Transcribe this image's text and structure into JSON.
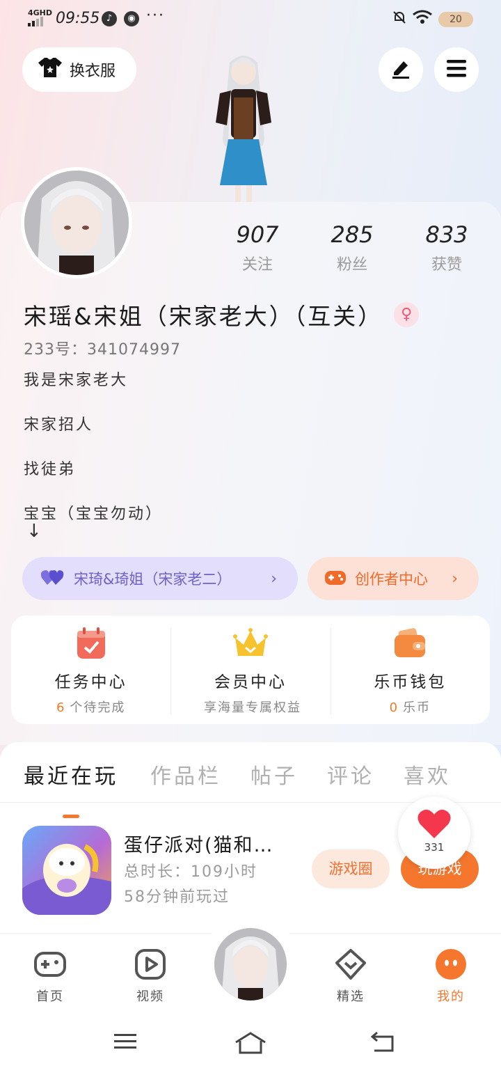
{
  "status_bar": {
    "network": "4GHD",
    "time": "09:55",
    "dots": "···",
    "battery": "20"
  },
  "header": {
    "outfit_label": "换衣服",
    "edit_icon": "pen-icon",
    "menu_icon": "hamburger-menu-icon"
  },
  "profile": {
    "stats": [
      {
        "value": "907",
        "label": "关注"
      },
      {
        "value": "285",
        "label": "粉丝"
      },
      {
        "value": "833",
        "label": "获赞"
      }
    ],
    "name": "宋瑶&宋姐（宋家老大）（互关）",
    "gender_icon": "female-icon",
    "uid": "233号：341074997",
    "bio": [
      "我是宋家老大",
      "宋家招人",
      "找徒弟",
      "宝宝（宝宝勿动）"
    ],
    "bio_arrow": "↓"
  },
  "relation": {
    "label": "宋琦&琦姐（宋家老二）",
    "icon": "double-heart-icon",
    "color": "#6e62c9"
  },
  "creator": {
    "label": "创作者中心",
    "icon": "gamepad-icon",
    "color": "#f06a2a"
  },
  "services": [
    {
      "title": "任务中心",
      "count": "6",
      "sub": "个待完成",
      "icon": "calendar-check-icon"
    },
    {
      "title": "会员中心",
      "count": "",
      "sub": "享海量专属权益",
      "icon": "crown-icon"
    },
    {
      "title": "乐币钱包",
      "count": "0",
      "sub": "乐币",
      "icon": "wallet-icon"
    }
  ],
  "tabs": [
    "最近在玩",
    "作品栏",
    "帖子",
    "评论",
    "喜欢"
  ],
  "active_tab": 0,
  "game": {
    "title": "蛋仔派对(猫和…",
    "total_time": "总时长：109小时",
    "last_played": "58分钟前玩过",
    "circle_label": "游戏圈",
    "play_label": "玩游戏"
  },
  "like_bubble": {
    "count": "331",
    "icon": "heart-icon"
  },
  "bottom_nav": [
    {
      "label": "首页",
      "icon": "gamepad-icon"
    },
    {
      "label": "视频",
      "icon": "play-icon"
    },
    {
      "label": "精选",
      "icon": "heart-box-icon"
    },
    {
      "label": "我的",
      "icon": "face-icon"
    }
  ],
  "accent_color": "#f5772e"
}
